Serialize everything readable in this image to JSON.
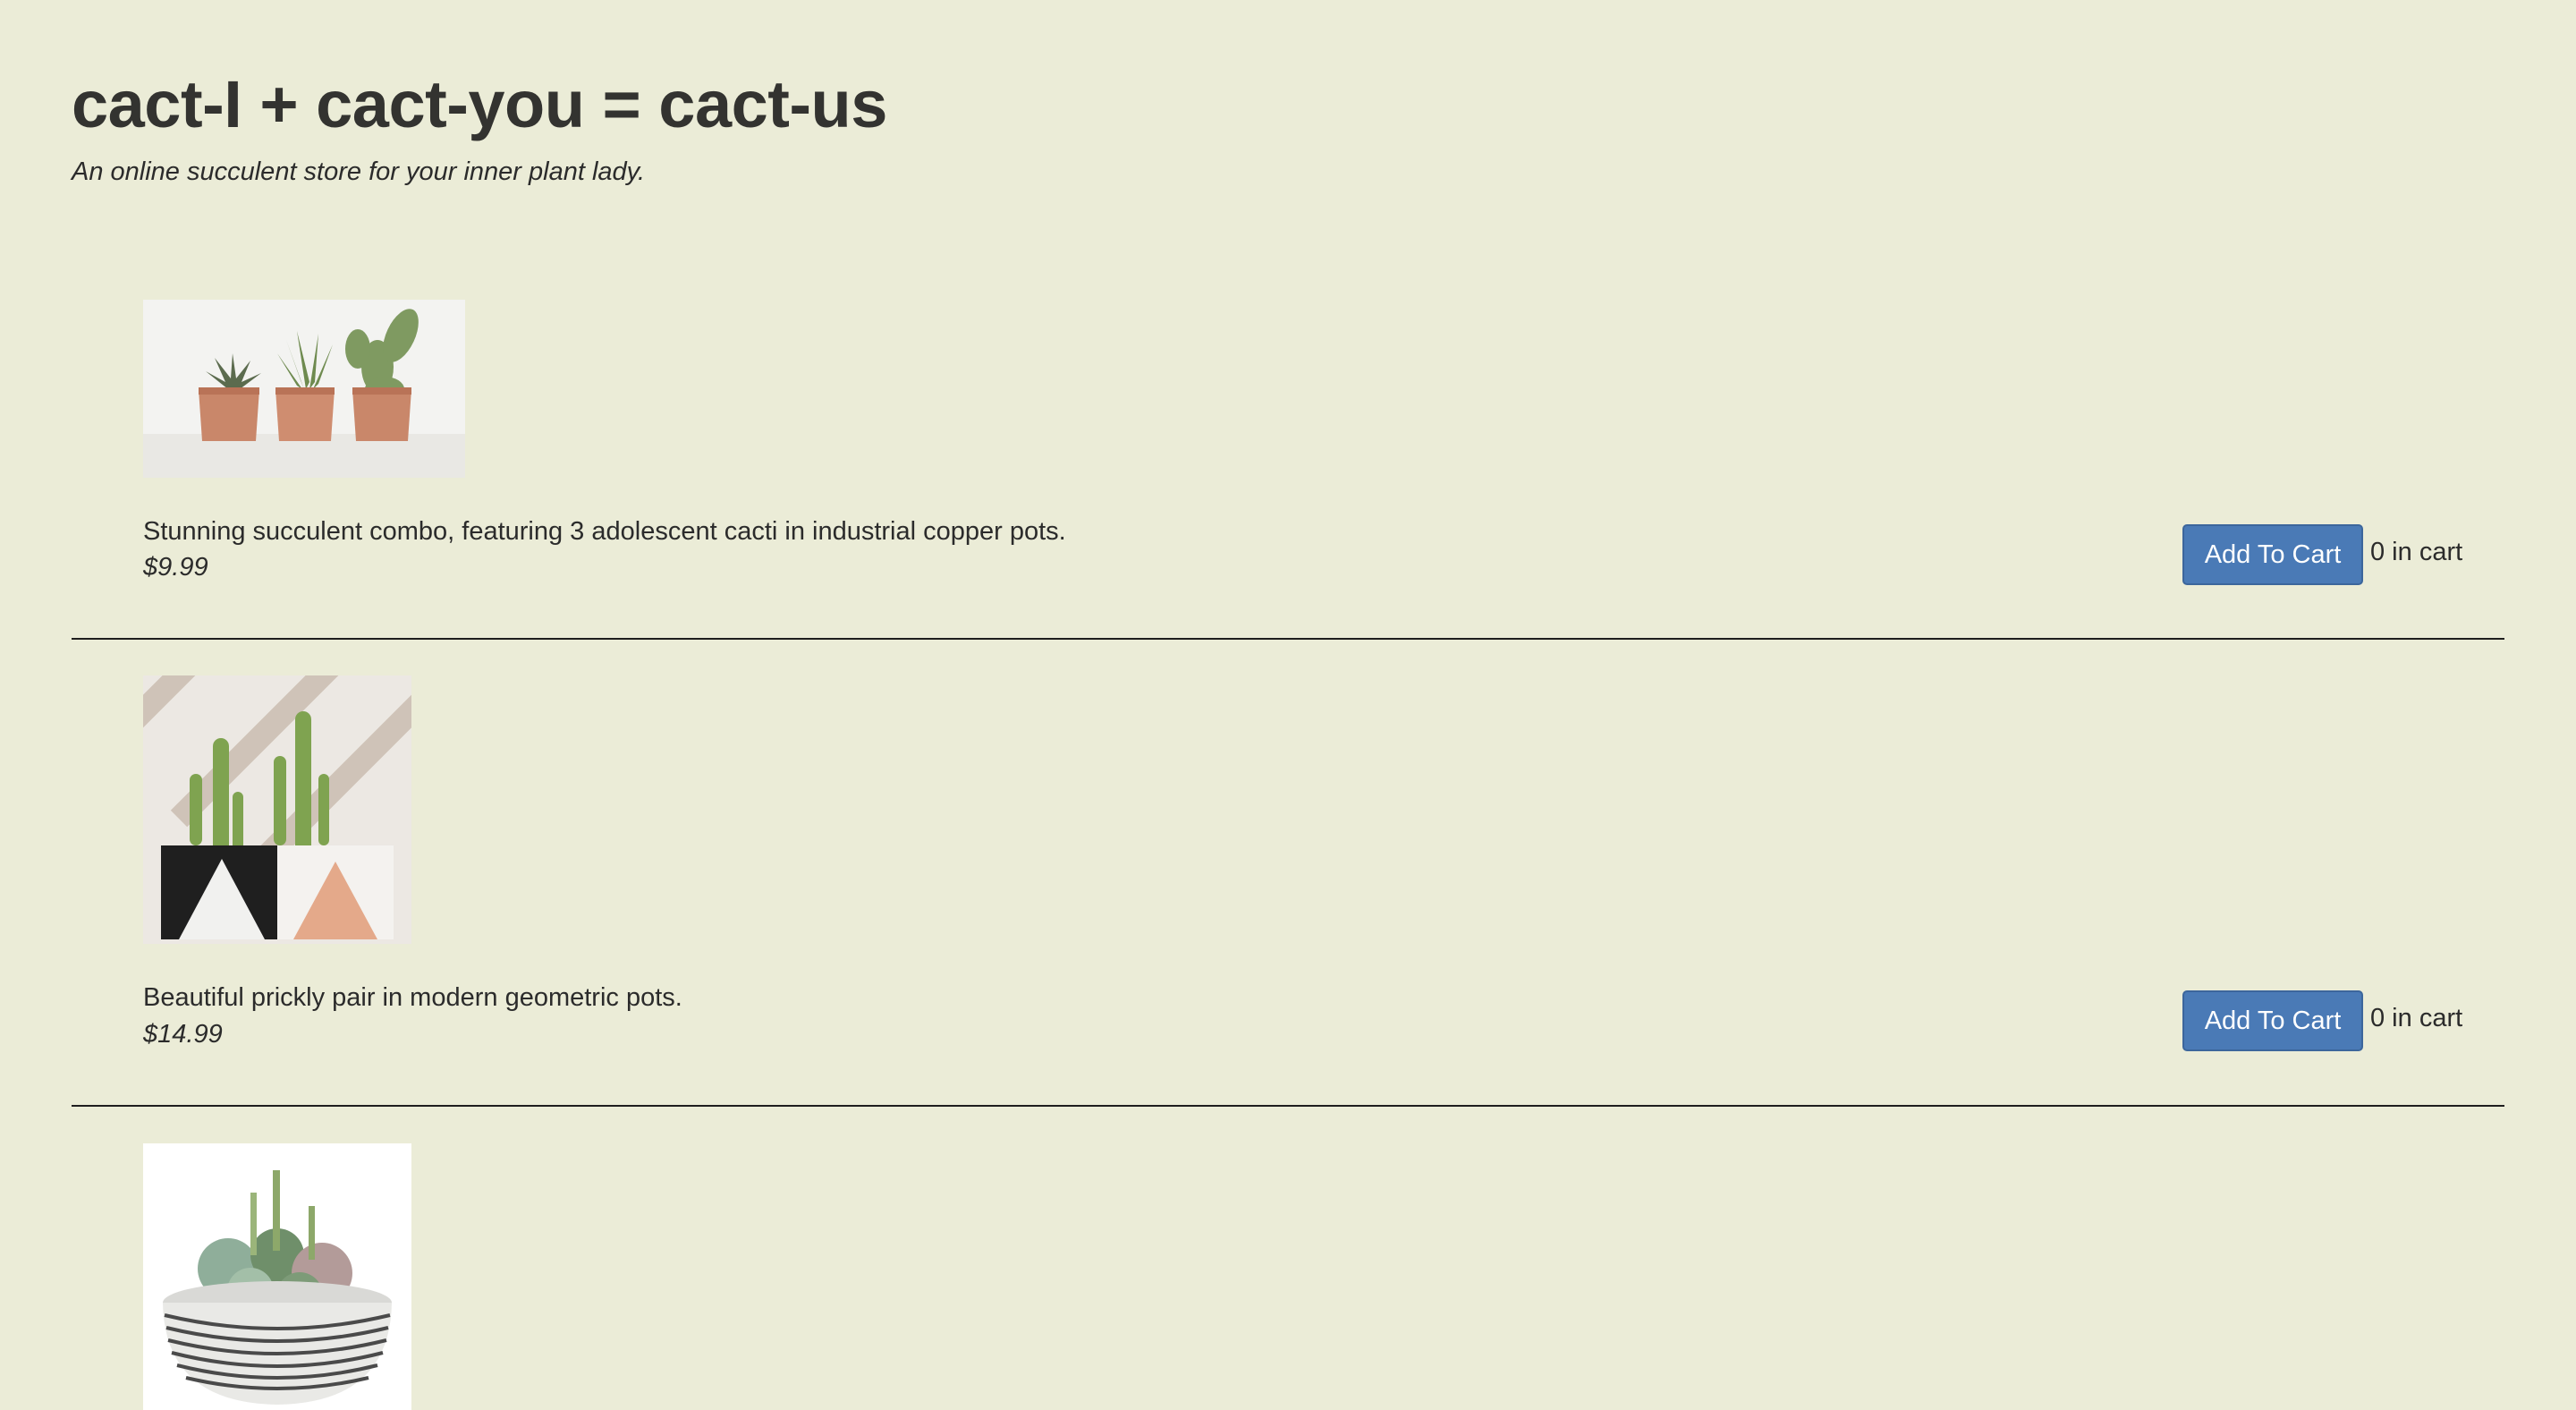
{
  "site": {
    "title": "cact-I + cact-you = cact-us",
    "tagline": "An online succulent store for your inner plant lady."
  },
  "products": [
    {
      "image_icon": "copper-pots-cacti-photo",
      "description": "Stunning succulent combo, featuring 3 adolescent cacti in industrial copper pots.",
      "price": "$9.99",
      "button_label": "Add To Cart",
      "cart_count": "0 in cart"
    },
    {
      "image_icon": "geometric-pots-cacti-photo",
      "description": "Beautiful prickly pair in modern geometric pots.",
      "price": "$14.99",
      "button_label": "Add To Cart",
      "cart_count": "0 in cart"
    },
    {
      "image_icon": "succulent-bowl-photo"
    }
  ],
  "colors": {
    "background": "#ebecd7",
    "button": "#4a7ab6",
    "text": "#2b2b2b"
  }
}
